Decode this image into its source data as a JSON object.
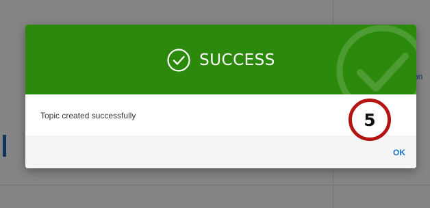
{
  "background": {
    "partial_text": "on",
    "overlay_color": "#000000"
  },
  "dialog": {
    "header_color": "#2b8a0c",
    "title": "SUCCESS",
    "title_icon": "check-circle-icon",
    "watermark_icon": "check-circle-icon",
    "message": "Topic created successfully",
    "ok_label": "OK",
    "ok_color": "#1a73c9"
  },
  "annotation": {
    "step_number": "5",
    "ring_color": "#b31512"
  }
}
